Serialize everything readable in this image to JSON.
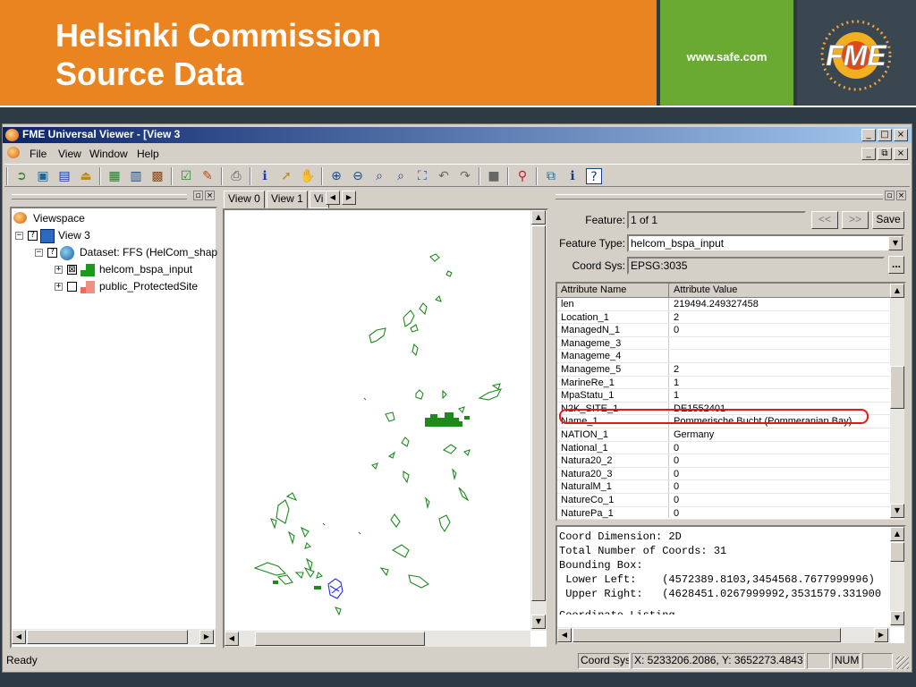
{
  "slide": {
    "title_line1": "Helsinki Commission",
    "title_line2": "Source Data",
    "url": "www.safe.com",
    "logo_text": "FME",
    "colors": {
      "orange": "#ea8420",
      "green": "#6aaa32",
      "dark": "#2e3a44"
    }
  },
  "window": {
    "title": "FME Universal Viewer - [View 3",
    "controls": [
      "_",
      "□",
      "×"
    ],
    "inner_controls": [
      "_",
      "⧉",
      "×"
    ]
  },
  "menu": [
    "File",
    "View",
    "Window",
    "Help"
  ],
  "toolbar_icons": [
    "open-icon",
    "import-icon",
    "save-icon",
    "export-icon",
    "add-view-icon",
    "new-view-icon",
    "view-settings-icon",
    "check-icon",
    "brush-icon",
    "print-icon",
    "info-icon",
    "select-icon",
    "pan-icon",
    "zoom-in-icon",
    "zoom-out-icon",
    "zoom-icon",
    "zoom-box-icon",
    "zoom-extent-icon",
    "undo-icon",
    "redo-icon",
    "stop-icon",
    "pin-icon",
    "layers-icon",
    "properties-icon",
    "help-icon"
  ],
  "tree": {
    "root": "Viewspace",
    "view": "View 3",
    "dataset": "Dataset: FFS (HelCom_shap",
    "layers": [
      {
        "label": "helcom_bspa_input",
        "checked": "⊠",
        "color": "#1a9a1a"
      },
      {
        "label": "public_ProtectedSite",
        "checked": "",
        "color": "#ee6a5a"
      }
    ]
  },
  "view_tabs": [
    "View 0",
    "View 1",
    "Vi"
  ],
  "inspector": {
    "feature_label": "Feature:",
    "feature_value": "1 of 1",
    "prev": "<<",
    "next": ">>",
    "save": "Save",
    "feature_type_label": "Feature Type:",
    "feature_type_value": "helcom_bspa_input",
    "coord_sys_label": "Coord Sys:",
    "coord_sys_value": "EPSG:3035",
    "browse": "...",
    "col_name": "Attribute Name",
    "col_value": "Attribute Value",
    "rows": [
      {
        "name": "len",
        "value": "219494.249327458"
      },
      {
        "name": "Location_1",
        "value": "2"
      },
      {
        "name": "ManagedN_1",
        "value": "0"
      },
      {
        "name": "Manageme_3",
        "value": ""
      },
      {
        "name": "Manageme_4",
        "value": ""
      },
      {
        "name": "Manageme_5",
        "value": "2"
      },
      {
        "name": "MarineRe_1",
        "value": "1"
      },
      {
        "name": "MpaStatu_1",
        "value": "1"
      },
      {
        "name": "N2K_SITE_1",
        "value": "DE1552401"
      },
      {
        "name": "Name_1",
        "value": "Pommerische Bucht (Pommeranian Bay)"
      },
      {
        "name": "NATION_1",
        "value": "Germany"
      },
      {
        "name": "National_1",
        "value": "0"
      },
      {
        "name": "Natura20_2",
        "value": "0"
      },
      {
        "name": "Natura20_3",
        "value": "0"
      },
      {
        "name": "NaturalM_1",
        "value": "0"
      },
      {
        "name": "NatureCo_1",
        "value": "0"
      },
      {
        "name": "NaturePa_1",
        "value": "0"
      }
    ],
    "geometry_lines": [
      "Coord Dimension: 2D",
      "Total Number of Coords: 31",
      "Bounding Box:",
      " Lower Left:    (4572389.8103,3454568.7677999996)",
      " Upper Right:   (4628451.0267999992,3531579.331900"
    ],
    "geometry_cutoff": "Coordinate Listing"
  },
  "status": {
    "text": "Ready",
    "coord_label": "Coord Sys",
    "coords": "X: 5233206.2086, Y: 3652273.4843",
    "num": "NUM"
  }
}
